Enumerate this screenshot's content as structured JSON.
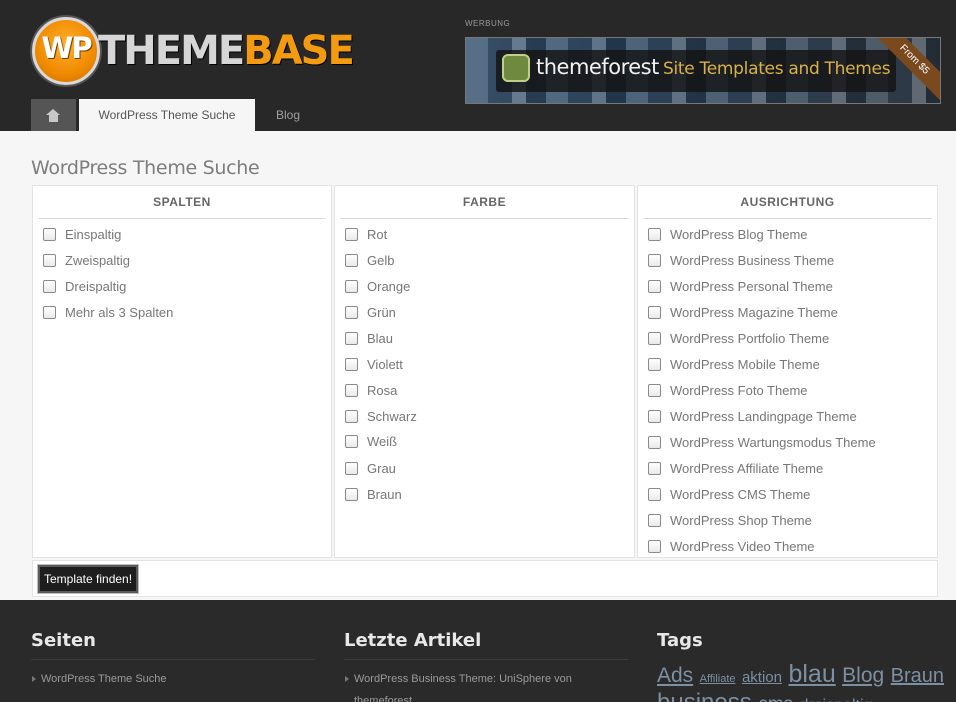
{
  "header": {
    "logo": {
      "wp": "WP",
      "theme": "THEME",
      "base": "BASE"
    },
    "ad_label": "WERBUNG",
    "ad": {
      "brand": "themeforest",
      "tagline": "Site Templates and Themes",
      "ribbon": "From $5"
    },
    "nav": {
      "home_icon": "home-icon",
      "items": [
        {
          "label": "WordPress Theme Suche",
          "active": true
        },
        {
          "label": "Blog",
          "active": false
        }
      ]
    }
  },
  "main": {
    "title": "WordPress Theme Suche",
    "columns": [
      {
        "heading": "SPALTEN",
        "options": [
          "Einspaltig",
          "Zweispaltig",
          "Dreispaltig",
          "Mehr als 3 Spalten"
        ]
      },
      {
        "heading": "FARBE",
        "options": [
          "Rot",
          "Gelb",
          "Orange",
          "Grün",
          "Blau",
          "Violett",
          "Rosa",
          "Schwarz",
          "Weiß",
          "Grau",
          "Braun"
        ]
      },
      {
        "heading": "AUSRICHTUNG",
        "options": [
          "WordPress Blog Theme",
          "WordPress Business Theme",
          "WordPress Personal Theme",
          "WordPress Magazine Theme",
          "WordPress Portfolio Theme",
          "WordPress Mobile Theme",
          "WordPress Foto Theme",
          "WordPress Landingpage Theme",
          "WordPress Wartungsmodus Theme",
          "WordPress Affiliate Theme",
          "WordPress CMS Theme",
          "WordPress Shop Theme",
          "WordPress Video Theme"
        ]
      }
    ],
    "submit_label": "Template finden!"
  },
  "footer": {
    "pages": {
      "heading": "Seiten",
      "items": [
        "WordPress Theme Suche"
      ]
    },
    "articles": {
      "heading": "Letzte Artikel",
      "items": [
        "WordPress Business Theme: UniSphere von themeforest"
      ]
    },
    "tags": {
      "heading": "Tags",
      "items": [
        "Ads",
        "Affiliate",
        "aktion",
        "blau",
        "Blog",
        "Braun",
        "business",
        "cms",
        "dreispaltig"
      ]
    }
  }
}
